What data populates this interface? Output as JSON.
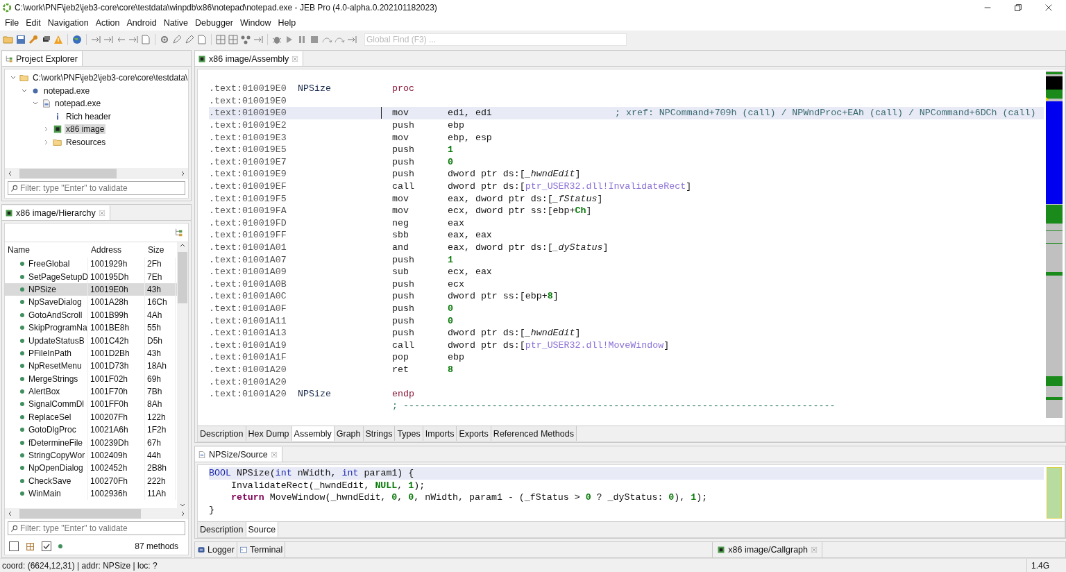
{
  "window": {
    "title": "C:\\work\\PNF\\jeb2\\jeb3-core\\core\\testdata\\winpdb\\x86\\notepad\\notepad.exe - JEB Pro (4.0-alpha.0.202101182023)"
  },
  "menu": [
    "File",
    "Edit",
    "Navigation",
    "Action",
    "Android",
    "Native",
    "Debugger",
    "Window",
    "Help"
  ],
  "global_find": {
    "placeholder": "Global Find (F3) ..."
  },
  "project_explorer": {
    "tab": "Project Explorer",
    "tree": [
      {
        "label": "C:\\work\\PNF\\jeb2\\jeb3-core\\core\\testdata\\",
        "kind": "folder",
        "expanded": true,
        "selected": false,
        "children": [
          {
            "label": "notepad.exe",
            "kind": "artifact",
            "expanded": true,
            "selected": false,
            "children": [
              {
                "label": "notepad.exe",
                "kind": "pe",
                "expanded": true,
                "selected": false,
                "children": [
                  {
                    "label": "Rich header",
                    "kind": "info",
                    "selected": false
                  },
                  {
                    "label": "x86 image",
                    "kind": "chip",
                    "expanded": false,
                    "selected": true
                  },
                  {
                    "label": "Resources",
                    "kind": "folder",
                    "expanded": false,
                    "selected": false
                  }
                ]
              }
            ]
          }
        ]
      }
    ],
    "filter": {
      "placeholder": "Filter: type \"Enter\" to validate"
    }
  },
  "hierarchy": {
    "tab": "x86 image/Hierarchy",
    "columns": [
      "Name",
      "Address",
      "Size"
    ],
    "rows": [
      {
        "name": "FreeGlobal",
        "address": "1001929h",
        "size": "2Fh",
        "selected": false
      },
      {
        "name": "SetPageSetupD",
        "address": "100195Dh",
        "size": "7Eh",
        "selected": false
      },
      {
        "name": "NPSize",
        "address": "10019E0h",
        "size": "43h",
        "selected": true
      },
      {
        "name": "NpSaveDialog",
        "address": "1001A28h",
        "size": "16Ch",
        "selected": false
      },
      {
        "name": "GotoAndScroll",
        "address": "1001B99h",
        "size": "4Ah",
        "selected": false
      },
      {
        "name": "SkipProgramNa",
        "address": "1001BE8h",
        "size": "55h",
        "selected": false
      },
      {
        "name": "UpdateStatusB",
        "address": "1001C42h",
        "size": "D5h",
        "selected": false
      },
      {
        "name": "PFileInPath",
        "address": "1001D2Bh",
        "size": "43h",
        "selected": false
      },
      {
        "name": "NpResetMenu",
        "address": "1001D73h",
        "size": "18Ah",
        "selected": false
      },
      {
        "name": "MergeStrings",
        "address": "1001F02h",
        "size": "69h",
        "selected": false
      },
      {
        "name": "AlertBox",
        "address": "1001F70h",
        "size": "7Bh",
        "selected": false
      },
      {
        "name": "SignalCommDl",
        "address": "1001FF0h",
        "size": "8Ah",
        "selected": false
      },
      {
        "name": "ReplaceSel",
        "address": "100207Fh",
        "size": "122h",
        "selected": false
      },
      {
        "name": "GotoDlgProc",
        "address": "10021A6h",
        "size": "1F2h",
        "selected": false
      },
      {
        "name": "fDetermineFile",
        "address": "100239Dh",
        "size": "67h",
        "selected": false
      },
      {
        "name": "StringCopyWor",
        "address": "1002409h",
        "size": "44h",
        "selected": false
      },
      {
        "name": "NpOpenDialog",
        "address": "1002452h",
        "size": "2B8h",
        "selected": false
      },
      {
        "name": "CheckSave",
        "address": "100270Fh",
        "size": "222h",
        "selected": false
      },
      {
        "name": "WinMain",
        "address": "1002936h",
        "size": "11Ah",
        "selected": false
      }
    ],
    "filter": {
      "placeholder": "Filter: type \"Enter\" to validate"
    },
    "toggles": [
      {
        "kind": "checkbox",
        "checked": false
      },
      {
        "kind": "grid"
      },
      {
        "kind": "checkbox",
        "checked": true
      },
      {
        "kind": "dot"
      }
    ],
    "count": "87 methods"
  },
  "assembly": {
    "tab": "x86 image/Assembly",
    "lines": [
      {
        "address": ".text:010019E0",
        "label": "NPSize",
        "mnemonic": "proc",
        "kind": "directive",
        "selected": false
      },
      {
        "address": ".text:010019E0",
        "selected": false
      },
      {
        "address": ".text:010019E0",
        "mnemonic": "mov",
        "operands": [
          {
            "text": "edi, edi",
            "kind": "plain"
          }
        ],
        "comment": "; xref: NPCommand+709h (call) / NPWndProc+EAh (call) / NPCommand+6DCh (call)",
        "selected": true
      },
      {
        "address": ".text:010019E2",
        "mnemonic": "push",
        "operands": [
          {
            "text": "ebp",
            "kind": "plain"
          }
        ],
        "selected": false
      },
      {
        "address": ".text:010019E3",
        "mnemonic": "mov",
        "operands": [
          {
            "text": "ebp, esp",
            "kind": "plain"
          }
        ],
        "selected": false
      },
      {
        "address": ".text:010019E5",
        "mnemonic": "push",
        "operands": [
          {
            "text": "1",
            "kind": "num"
          }
        ],
        "selected": false
      },
      {
        "address": ".text:010019E7",
        "mnemonic": "push",
        "operands": [
          {
            "text": "0",
            "kind": "num"
          }
        ],
        "selected": false
      },
      {
        "address": ".text:010019E9",
        "mnemonic": "push",
        "operands": [
          {
            "text": "dword ptr ds:[",
            "kind": "plain"
          },
          {
            "text": "_hwndEdit",
            "kind": "global"
          },
          {
            "text": "]",
            "kind": "plain"
          }
        ],
        "selected": false
      },
      {
        "address": ".text:010019EF",
        "mnemonic": "call",
        "operands": [
          {
            "text": "dword ptr ds:[",
            "kind": "plain"
          },
          {
            "text": "ptr_USER32.dll!InvalidateRect",
            "kind": "ref"
          },
          {
            "text": "]",
            "kind": "plain"
          }
        ],
        "selected": false
      },
      {
        "address": ".text:010019F5",
        "mnemonic": "mov",
        "operands": [
          {
            "text": "eax, dword ptr ds:[",
            "kind": "plain"
          },
          {
            "text": "_fStatus",
            "kind": "global"
          },
          {
            "text": "]",
            "kind": "plain"
          }
        ],
        "selected": false
      },
      {
        "address": ".text:010019FA",
        "mnemonic": "mov",
        "operands": [
          {
            "text": "ecx, dword ptr ss:[ebp+",
            "kind": "plain"
          },
          {
            "text": "Ch",
            "kind": "num"
          },
          {
            "text": "]",
            "kind": "plain"
          }
        ],
        "selected": false
      },
      {
        "address": ".text:010019FD",
        "mnemonic": "neg",
        "operands": [
          {
            "text": "eax",
            "kind": "plain"
          }
        ],
        "selected": false
      },
      {
        "address": ".text:010019FF",
        "mnemonic": "sbb",
        "operands": [
          {
            "text": "eax, eax",
            "kind": "plain"
          }
        ],
        "selected": false
      },
      {
        "address": ".text:01001A01",
        "mnemonic": "and",
        "operands": [
          {
            "text": "eax, dword ptr ds:[",
            "kind": "plain"
          },
          {
            "text": "_dyStatus",
            "kind": "global"
          },
          {
            "text": "]",
            "kind": "plain"
          }
        ],
        "selected": false
      },
      {
        "address": ".text:01001A07",
        "mnemonic": "push",
        "operands": [
          {
            "text": "1",
            "kind": "num"
          }
        ],
        "selected": false
      },
      {
        "address": ".text:01001A09",
        "mnemonic": "sub",
        "operands": [
          {
            "text": "ecx, eax",
            "kind": "plain"
          }
        ],
        "selected": false
      },
      {
        "address": ".text:01001A0B",
        "mnemonic": "push",
        "operands": [
          {
            "text": "ecx",
            "kind": "plain"
          }
        ],
        "selected": false
      },
      {
        "address": ".text:01001A0C",
        "mnemonic": "push",
        "operands": [
          {
            "text": "dword ptr ss:[ebp+",
            "kind": "plain"
          },
          {
            "text": "8",
            "kind": "num"
          },
          {
            "text": "]",
            "kind": "plain"
          }
        ],
        "selected": false
      },
      {
        "address": ".text:01001A0F",
        "mnemonic": "push",
        "operands": [
          {
            "text": "0",
            "kind": "num"
          }
        ],
        "selected": false
      },
      {
        "address": ".text:01001A11",
        "mnemonic": "push",
        "operands": [
          {
            "text": "0",
            "kind": "num"
          }
        ],
        "selected": false
      },
      {
        "address": ".text:01001A13",
        "mnemonic": "push",
        "operands": [
          {
            "text": "dword ptr ds:[",
            "kind": "plain"
          },
          {
            "text": "_hwndEdit",
            "kind": "global"
          },
          {
            "text": "]",
            "kind": "plain"
          }
        ],
        "selected": false
      },
      {
        "address": ".text:01001A19",
        "mnemonic": "call",
        "operands": [
          {
            "text": "dword ptr ds:[",
            "kind": "plain"
          },
          {
            "text": "ptr_USER32.dll!MoveWindow",
            "kind": "ref"
          },
          {
            "text": "]",
            "kind": "plain"
          }
        ],
        "selected": false
      },
      {
        "address": ".text:01001A1F",
        "mnemonic": "pop",
        "operands": [
          {
            "text": "ebp",
            "kind": "plain"
          }
        ],
        "selected": false
      },
      {
        "address": ".text:01001A20",
        "mnemonic": "ret",
        "operands": [
          {
            "text": "8",
            "kind": "num"
          }
        ],
        "selected": false
      },
      {
        "address": ".text:01001A20",
        "selected": false
      },
      {
        "address": ".text:01001A20",
        "label": "NPSize",
        "mnemonic": "endp",
        "kind": "directive",
        "selected": false
      },
      {
        "mnemonic": "; ------------------------------------------------------------------------------",
        "kind": "separator",
        "selected": false
      }
    ],
    "views": [
      {
        "label": "Description",
        "selected": false
      },
      {
        "label": "Hex Dump",
        "selected": false
      },
      {
        "label": "Assembly",
        "selected": true
      },
      {
        "label": "Graph",
        "selected": false
      },
      {
        "label": "Strings",
        "selected": false
      },
      {
        "label": "Types",
        "selected": false
      },
      {
        "label": "Imports",
        "selected": false
      },
      {
        "label": "Exports",
        "selected": false
      },
      {
        "label": "Referenced Methods",
        "selected": false
      }
    ]
  },
  "source": {
    "tab": "NPSize/Source",
    "lines": [
      {
        "selected": true,
        "tokens": [
          {
            "text": "BOOL",
            "kind": "type"
          },
          {
            "text": " NPSize(",
            "kind": "plain"
          },
          {
            "text": "int",
            "kind": "type"
          },
          {
            "text": " nWidth, ",
            "kind": "plain"
          },
          {
            "text": "int",
            "kind": "type"
          },
          {
            "text": " param1) {",
            "kind": "plain"
          }
        ]
      },
      {
        "selected": false,
        "tokens": [
          {
            "text": "    InvalidateRect(_hwndEdit, ",
            "kind": "plain"
          },
          {
            "text": "NULL",
            "kind": "const"
          },
          {
            "text": ", ",
            "kind": "plain"
          },
          {
            "text": "1",
            "kind": "num"
          },
          {
            "text": ");",
            "kind": "plain"
          }
        ]
      },
      {
        "selected": false,
        "tokens": [
          {
            "text": "    return",
            "kind": "keyword"
          },
          {
            "text": " MoveWindow(_hwndEdit, ",
            "kind": "plain"
          },
          {
            "text": "0",
            "kind": "num"
          },
          {
            "text": ", ",
            "kind": "plain"
          },
          {
            "text": "0",
            "kind": "num"
          },
          {
            "text": ", nWidth, param1 - (_fStatus > ",
            "kind": "plain"
          },
          {
            "text": "0",
            "kind": "num"
          },
          {
            "text": " ? _dyStatus: ",
            "kind": "plain"
          },
          {
            "text": "0",
            "kind": "num"
          },
          {
            "text": "), ",
            "kind": "plain"
          },
          {
            "text": "1",
            "kind": "num"
          },
          {
            "text": ");",
            "kind": "plain"
          }
        ]
      },
      {
        "selected": false,
        "tokens": [
          {
            "text": "}",
            "kind": "plain"
          }
        ]
      }
    ],
    "views": [
      {
        "label": "Description",
        "selected": false
      },
      {
        "label": "Source",
        "selected": true
      }
    ]
  },
  "bottom_tabs": [
    {
      "label": "Logger",
      "kind": "logger"
    },
    {
      "label": "Terminal",
      "kind": "terminal"
    }
  ],
  "callgraph_tab": "x86 image/Callgraph",
  "status_bar": {
    "text": "coord: (6624,12,31) | addr: NPSize | loc: ?",
    "memory": "1.4G"
  }
}
